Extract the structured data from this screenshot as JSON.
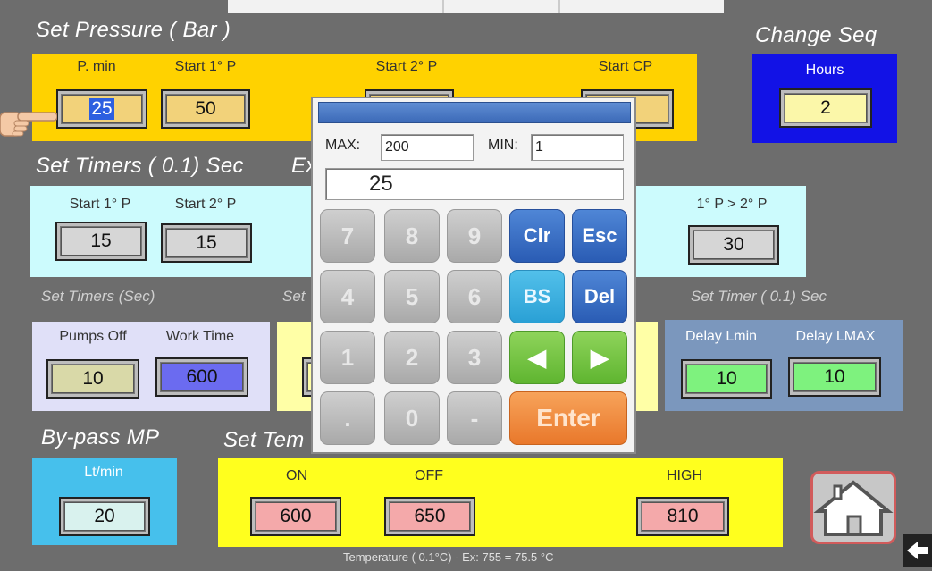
{
  "titles": {
    "set_pressure": "Set Pressure ( Bar )",
    "change_seq": "Change Seq",
    "set_timers_01": "Set Timers ( 0.1) Sec",
    "set_timers_01_ex": "Ex",
    "set_timers_sec": "Set Timers (Sec)",
    "set_timers_sec_2": "Set",
    "set_timer_01_sec": "Set Timer ( 0.1) Sec",
    "bypass_mp": "By-pass MP",
    "set_temp": "Set Tem",
    "temperature_note": "Temperature ( 0.1°C) - Ex: 755 = 75.5 °C"
  },
  "pressure": {
    "p_min_label": "P. min",
    "p_min_value": "25",
    "start1_label": "Start  1° P",
    "start1_value": "50",
    "start2_label": "Start 2° P",
    "start_cp_label": "Start CP"
  },
  "change_seq": {
    "hours_label": "Hours",
    "hours_value": "2"
  },
  "timers01": {
    "start1_label": "Start  1° P",
    "start1_value": "15",
    "start2_label": "Start 2° P",
    "start2_value": "15",
    "p1p2_label": "1° P > 2° P",
    "p1p2_value": "30"
  },
  "timers_sec": {
    "pumps_off_label": "Pumps Off",
    "pumps_off_value": "10",
    "work_time_label": "Work Time",
    "work_time_value": "600"
  },
  "timer01": {
    "delay_lmin_label": "Delay Lmin",
    "delay_lmin_value": "10",
    "delay_lmax_label": "Delay LMAX",
    "delay_lmax_value": "10"
  },
  "bypass": {
    "label": "Lt/min",
    "value": "20"
  },
  "temperature": {
    "on_label": "ON",
    "on_value": "600",
    "off_label": "OFF",
    "off_value": "650",
    "high_label": "HIGH",
    "high_value": "810"
  },
  "keypad": {
    "max_label": "MAX:",
    "max_value": "200",
    "min_label": "MIN:",
    "min_value": "1",
    "entry_value": "25",
    "keys": {
      "k7": "7",
      "k8": "8",
      "k9": "9",
      "clr": "Clr",
      "esc": "Esc",
      "k4": "4",
      "k5": "5",
      "k6": "6",
      "bs": "BS",
      "del": "Del",
      "k1": "1",
      "k2": "2",
      "k3": "3",
      "left": "◀",
      "right": "▶",
      "dot": ".",
      "k0": "0",
      "minus": "-",
      "enter": "Enter"
    }
  },
  "colors": {
    "pressure_panel": "#ffd200",
    "change_seq_panel": "#1212e6",
    "timers_panel": "#ccfbfd",
    "timers_sec_panel": "#e0e0f8",
    "timer01_panel": "#7b97bd",
    "bypass_panel": "#46c0ec",
    "temp_panel": "#ffff1e"
  },
  "icons": {
    "home": "home-icon",
    "back": "back-arrow-icon",
    "pointer": "pointing-hand-icon"
  }
}
